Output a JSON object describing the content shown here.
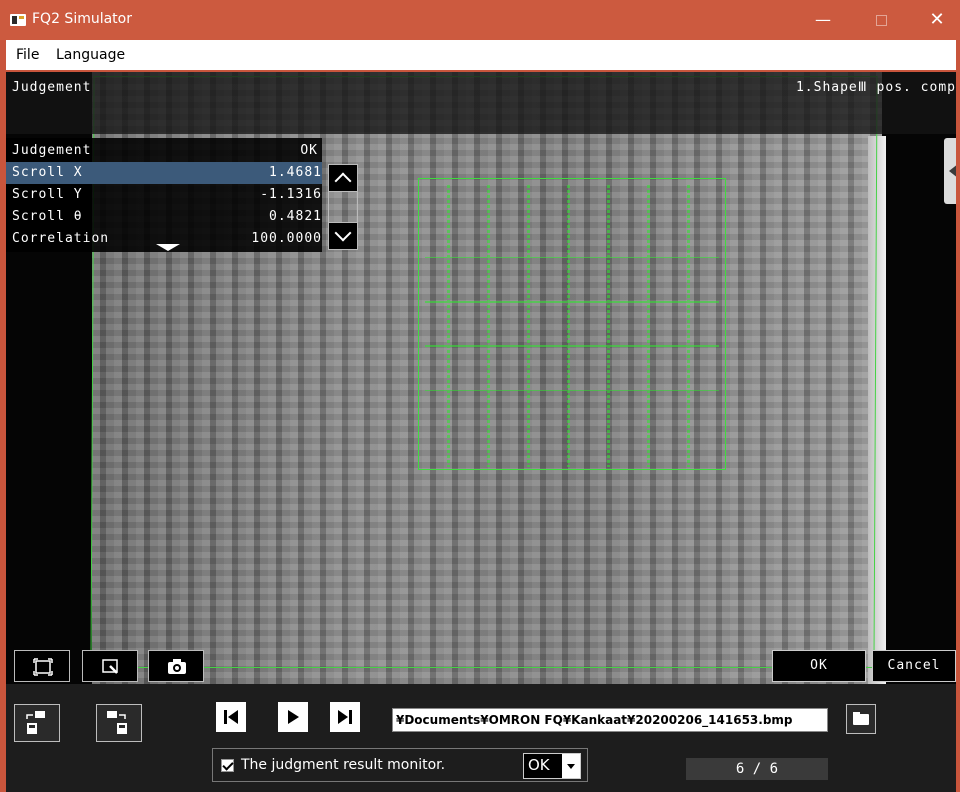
{
  "window": {
    "title": "FQ2 Simulator"
  },
  "menu": {
    "items": [
      "File",
      "Language"
    ]
  },
  "viewport": {
    "mode_label": "Judgement",
    "item_label": "1.ShapeⅢ pos. comp"
  },
  "results": {
    "header": {
      "label": "Judgement",
      "value": "OK"
    },
    "rows": [
      {
        "label": "Scroll X",
        "value": "1.4681"
      },
      {
        "label": "Scroll Y",
        "value": "-1.1316"
      },
      {
        "label": "Scroll θ",
        "value": "0.4821"
      },
      {
        "label": "Correlation",
        "value": "100.0000"
      }
    ],
    "selected_row": 0
  },
  "buttons": {
    "ok": "OK",
    "cancel": "Cancel"
  },
  "file": {
    "path": "¥Documents¥OMRON FQ¥Kankaat¥20200206_141653.bmp"
  },
  "monitor": {
    "label": "The judgment result monitor.",
    "checked": true,
    "filter_value": "OK"
  },
  "page": {
    "current": "6",
    "total": "6",
    "display": "6 / 6"
  },
  "colors": {
    "titlebar": "#cc5a3f",
    "overlay_green": "#3fdc3f",
    "selected_row": "#3c5a7a"
  },
  "icons": [
    "app-icon",
    "minimize-icon",
    "maximize-icon",
    "close-icon",
    "fit-screen-icon",
    "zoom-icon",
    "camera-icon",
    "import-image-icon",
    "export-image-icon",
    "first-frame-icon",
    "play-icon",
    "last-frame-icon",
    "folder-icon",
    "scroll-up-icon",
    "scroll-down-icon",
    "expand-icon",
    "panel-toggle-icon"
  ]
}
